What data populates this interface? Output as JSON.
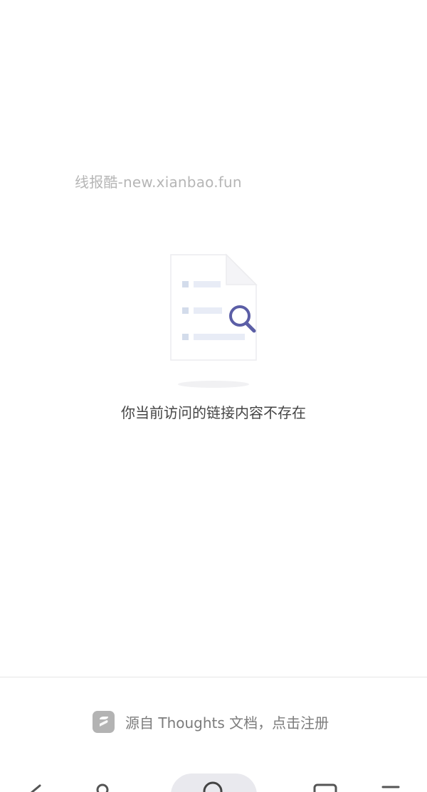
{
  "watermark": {
    "text": "线报酷-new.xianbao.fun"
  },
  "empty_state": {
    "illustration_icon": "document-search-icon",
    "message": "你当前访问的链接内容不存在"
  },
  "footer": {
    "logo_icon": "thoughts-logo-icon",
    "link_text": "源自 Thoughts 文档，点击注册"
  },
  "nav": {
    "back_icon": "chevron-left-icon",
    "user_icon": "person-icon",
    "home_icon": "search-icon",
    "tabs_icon": "square-icon",
    "menu_icon": "menu-icon"
  },
  "colors": {
    "accent": "#5b5ea6",
    "placeholder_line": "#e8ecf6",
    "placeholder_bullet": "#d3dceb",
    "text_primary": "#444444",
    "text_secondary": "#7c7c7c",
    "watermark": "#b6b6b6"
  }
}
